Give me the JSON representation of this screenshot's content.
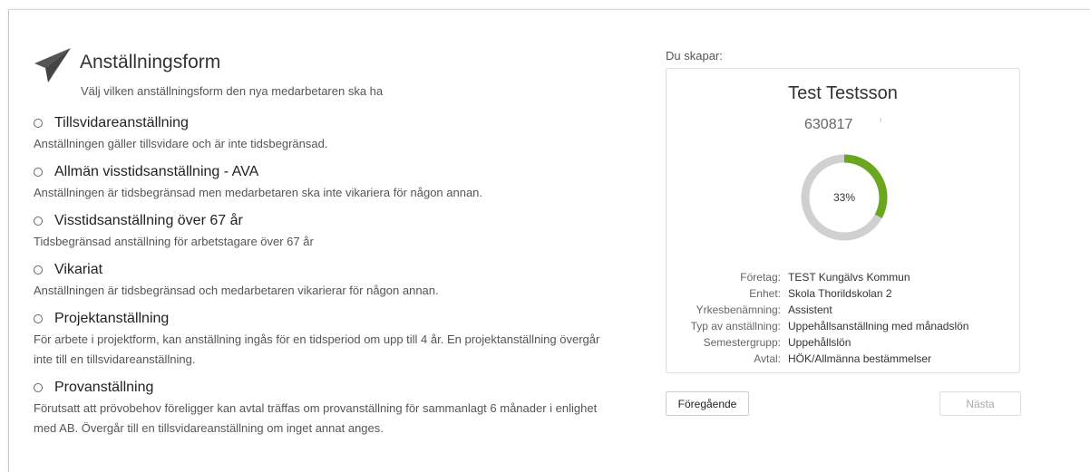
{
  "header": {
    "title": "Anställningsform",
    "subtitle": "Välj vilken anställningsform den nya medarbetaren ska ha",
    "icon": "paper-plane-icon"
  },
  "options": [
    {
      "label": "Tillsvidareanställning",
      "description": "Anställningen gäller tillsvidare och är inte tidsbegränsad."
    },
    {
      "label": "Allmän visstidsanställning - AVA",
      "description": "Anställningen är tidsbegränsad men medarbetaren ska inte vikariera för någon annan."
    },
    {
      "label": "Visstidsanställning över 67 år",
      "description": "Tidsbegränsad anställning för arbetstagare över 67 år"
    },
    {
      "label": "Vikariat",
      "description": "Anställningen är tidsbegränsad och medarbetaren vikarierar för någon annan."
    },
    {
      "label": "Projektanställning",
      "description": "För arbete i projektform, kan anställning ingås för en tidsperiod om upp till 4 år. En projektanställning övergår inte till en tillsvidareanställning."
    },
    {
      "label": "Provanställning",
      "description": "Förutsatt att prövobehov föreligger kan avtal träffas om provanställning för sammanlagt 6 månader i enlighet med AB. Övergår till en tillsvidareanställning om inget annat anges."
    }
  ],
  "summary": {
    "heading": "Du skapar:",
    "name": "Test Testsson",
    "id": "630817",
    "id_extra": "ı",
    "progress_label": "33%",
    "progress_value": 0.33,
    "progress_color": "#6aa61e",
    "track_color": "#d0d0d0",
    "fields": [
      {
        "key": "Företag:",
        "value": "TEST Kungälvs Kommun"
      },
      {
        "key": "Enhet:",
        "value": "Skola Thorildskolan 2"
      },
      {
        "key": "Yrkesbenämning:",
        "value": "Assistent"
      },
      {
        "key": "Typ av anställning:",
        "value": "Uppehållsanställning med månadslön"
      },
      {
        "key": "Semestergrupp:",
        "value": "Uppehållslön"
      },
      {
        "key": "Avtal:",
        "value": "HÖK/Allmänna bestämmelser"
      }
    ]
  },
  "buttons": {
    "prev": "Föregående",
    "next": "Nästa"
  }
}
